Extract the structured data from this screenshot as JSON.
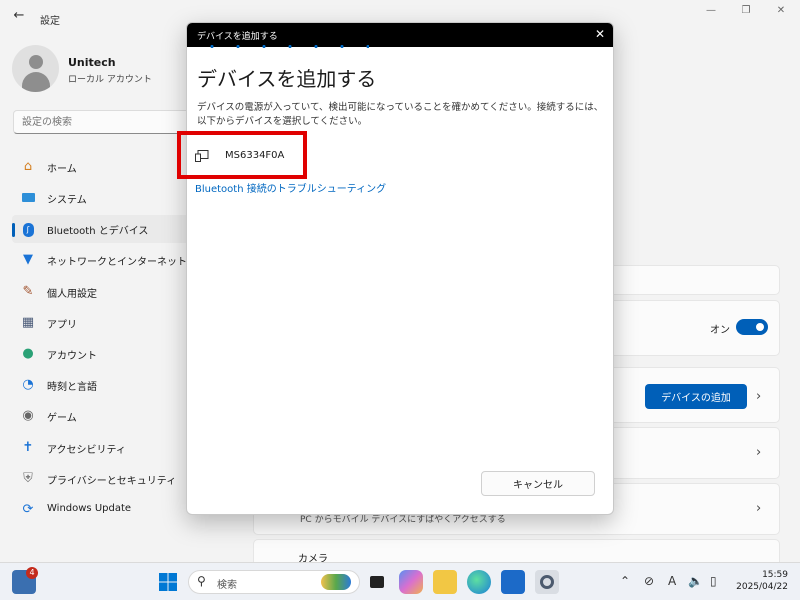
{
  "app": {
    "title": "設定",
    "back_icon": "back-arrow-icon",
    "window_controls": [
      "minimize-icon",
      "maximize-icon",
      "close-icon"
    ]
  },
  "profile": {
    "name": "Unitech",
    "account_type": "ローカル アカウント"
  },
  "search": {
    "placeholder": "設定の検索"
  },
  "sidebar": {
    "items": [
      {
        "label": "ホーム",
        "icon": "home-icon",
        "active": false
      },
      {
        "label": "システム",
        "icon": "system-icon",
        "active": false
      },
      {
        "label": "Bluetooth とデバイス",
        "icon": "bluetooth-icon",
        "active": true
      },
      {
        "label": "ネットワークとインターネット",
        "icon": "wifi-icon",
        "active": false
      },
      {
        "label": "個人用設定",
        "icon": "brush-icon",
        "active": false
      },
      {
        "label": "アプリ",
        "icon": "apps-icon",
        "active": false
      },
      {
        "label": "アカウント",
        "icon": "account-icon",
        "active": false
      },
      {
        "label": "時刻と言語",
        "icon": "globe-clock-icon",
        "active": false
      },
      {
        "label": "ゲーム",
        "icon": "gamepad-icon",
        "active": false
      },
      {
        "label": "アクセシビリティ",
        "icon": "accessibility-icon",
        "active": false
      },
      {
        "label": "プライバシーとセキュリティ",
        "icon": "shield-icon",
        "active": false
      },
      {
        "label": "Windows Update",
        "icon": "update-icon",
        "active": false
      }
    ]
  },
  "main": {
    "bluetooth_toggle_label": "オン",
    "bluetooth_toggle_on": true,
    "add_device_button": "デバイスの追加",
    "partial_row_text": "PC からモバイル デバイスにすばやくアクセスする",
    "camera_label": "カメラ"
  },
  "dialog": {
    "window_title": "デバイスを追加する",
    "heading": "デバイスを追加する",
    "description": "デバイスの電源が入っていて、検出可能になっていることを確かめてください。接続するには、以下からデバイスを選択してください。",
    "devices": [
      {
        "name": "MS6334F0A",
        "icon": "device-icon"
      }
    ],
    "troubleshoot_link": "Bluetooth 接続のトラブルシューティング",
    "cancel_button": "キャンセル"
  },
  "taskbar": {
    "search_placeholder": "検索",
    "widgets_badge": "4",
    "time": "15:59",
    "date": "2025/04/22",
    "ime_indicator": "A"
  },
  "colors": {
    "accent": "#005fb8",
    "highlight_box": "#e00000",
    "link": "#0067c0"
  }
}
